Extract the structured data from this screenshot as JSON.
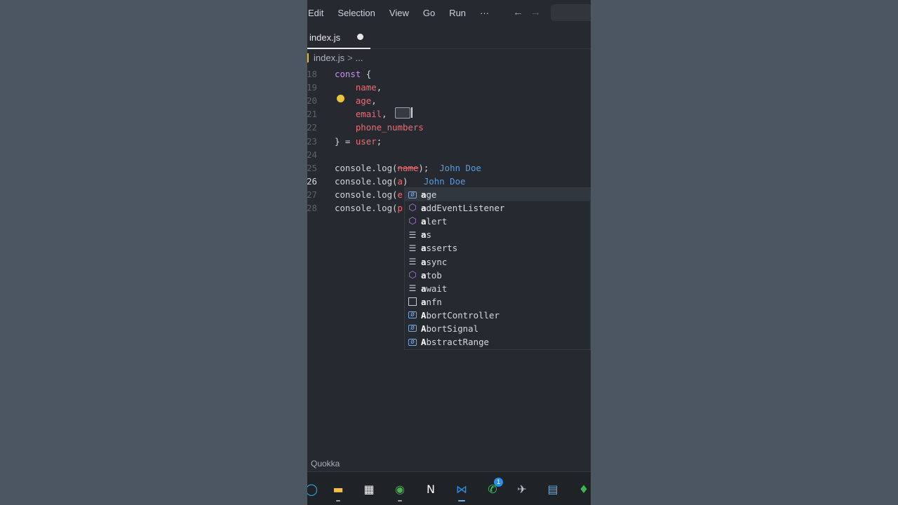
{
  "menubar": {
    "items": [
      "Edit",
      "Selection",
      "View",
      "Go",
      "Run",
      "···"
    ],
    "back_icon": "←",
    "forward_icon": "→"
  },
  "tab": {
    "label": "index.js"
  },
  "breadcrumb": {
    "file": "index.js",
    "sep": ">",
    "more": "..."
  },
  "editor": {
    "lines": [
      {
        "num": "18",
        "parts": [
          [
            "kw",
            "const "
          ],
          [
            "fn",
            "{"
          ]
        ]
      },
      {
        "num": "19",
        "parts": [
          [
            "fn",
            "    "
          ],
          [
            "var",
            "name"
          ],
          [
            "fn",
            ","
          ]
        ]
      },
      {
        "num": "20",
        "parts": [
          [
            "fn",
            "    "
          ],
          [
            "var",
            "age"
          ],
          [
            "fn",
            ","
          ]
        ]
      },
      {
        "num": "21",
        "parts": [
          [
            "fn",
            "    "
          ],
          [
            "var",
            "email"
          ],
          [
            "fn",
            ","
          ]
        ]
      },
      {
        "num": "22",
        "parts": [
          [
            "fn",
            "    "
          ],
          [
            "var",
            "phone_numbers"
          ]
        ]
      },
      {
        "num": "23",
        "parts": [
          [
            "fn",
            "} = "
          ],
          [
            "var",
            "user"
          ],
          [
            "fn",
            ";"
          ]
        ]
      },
      {
        "num": "24",
        "parts": []
      },
      {
        "num": "25",
        "parts": [
          [
            "fn",
            "console.log("
          ],
          [
            "var strike",
            "name"
          ],
          [
            "fn",
            ");  "
          ],
          [
            "quokka",
            "John Doe"
          ]
        ]
      },
      {
        "num": "26",
        "parts": [
          [
            "fn",
            "console.log("
          ],
          [
            "var",
            "a"
          ],
          [
            "fn",
            ")   "
          ],
          [
            "quokka",
            "John Doe"
          ]
        ],
        "current": true
      },
      {
        "num": "27",
        "parts": [
          [
            "fn",
            "console.log("
          ],
          [
            "var",
            "e"
          ]
        ]
      },
      {
        "num": "28",
        "parts": [
          [
            "fn",
            "console.log("
          ],
          [
            "var",
            "p"
          ]
        ]
      }
    ]
  },
  "suggestions": [
    {
      "kind": "var",
      "icon": "[ø]",
      "label": "age",
      "match": "a",
      "selected": true
    },
    {
      "kind": "method",
      "icon": "⬡",
      "label": "addEventListener",
      "match": "a"
    },
    {
      "kind": "method",
      "icon": "⬡",
      "label": "alert",
      "match": "a"
    },
    {
      "kind": "kw",
      "icon": "☰",
      "label": "as",
      "match": "a"
    },
    {
      "kind": "kw",
      "icon": "☰",
      "label": "asserts",
      "match": "a"
    },
    {
      "kind": "kw",
      "icon": "☰",
      "label": "async",
      "match": "a"
    },
    {
      "kind": "method",
      "icon": "⬡",
      "label": "atob",
      "match": "a"
    },
    {
      "kind": "kw",
      "icon": "☰",
      "label": "await",
      "match": "a"
    },
    {
      "kind": "snip",
      "icon": "□",
      "label": "anfn",
      "match": "a"
    },
    {
      "kind": "var",
      "icon": "[ø]",
      "label": "AbortController",
      "match": "A"
    },
    {
      "kind": "var",
      "icon": "[ø]",
      "label": "AbortSignal",
      "match": "A"
    },
    {
      "kind": "var",
      "icon": "[ø]",
      "label": "AbstractRange",
      "match": "A"
    }
  ],
  "statusbar": {
    "label": "Quokka"
  },
  "taskbar": {
    "icons": [
      {
        "name": "cortana-icon",
        "glyph": "◯",
        "color": "#2fb5f0"
      },
      {
        "name": "file-explorer-icon",
        "glyph": "▬",
        "color": "#f2c14b"
      },
      {
        "name": "microsoft-store-icon",
        "glyph": "▦",
        "color": "#ffffff"
      },
      {
        "name": "chrome-icon",
        "glyph": "◉",
        "color": "#4caf50"
      },
      {
        "name": "notion-icon",
        "glyph": "N",
        "color": "#ffffff"
      },
      {
        "name": "vscode-icon",
        "glyph": "⋈",
        "color": "#2d8de0"
      },
      {
        "name": "whatsapp-icon",
        "glyph": "✆",
        "color": "#2fd46c"
      },
      {
        "name": "app-icon",
        "glyph": "✈",
        "color": "#b8c0c8"
      },
      {
        "name": "calculator-icon",
        "glyph": "▤",
        "color": "#6ea8dc"
      },
      {
        "name": "mongodb-icon",
        "glyph": "♦",
        "color": "#3db454"
      }
    ],
    "whatsapp_badge": "1"
  }
}
